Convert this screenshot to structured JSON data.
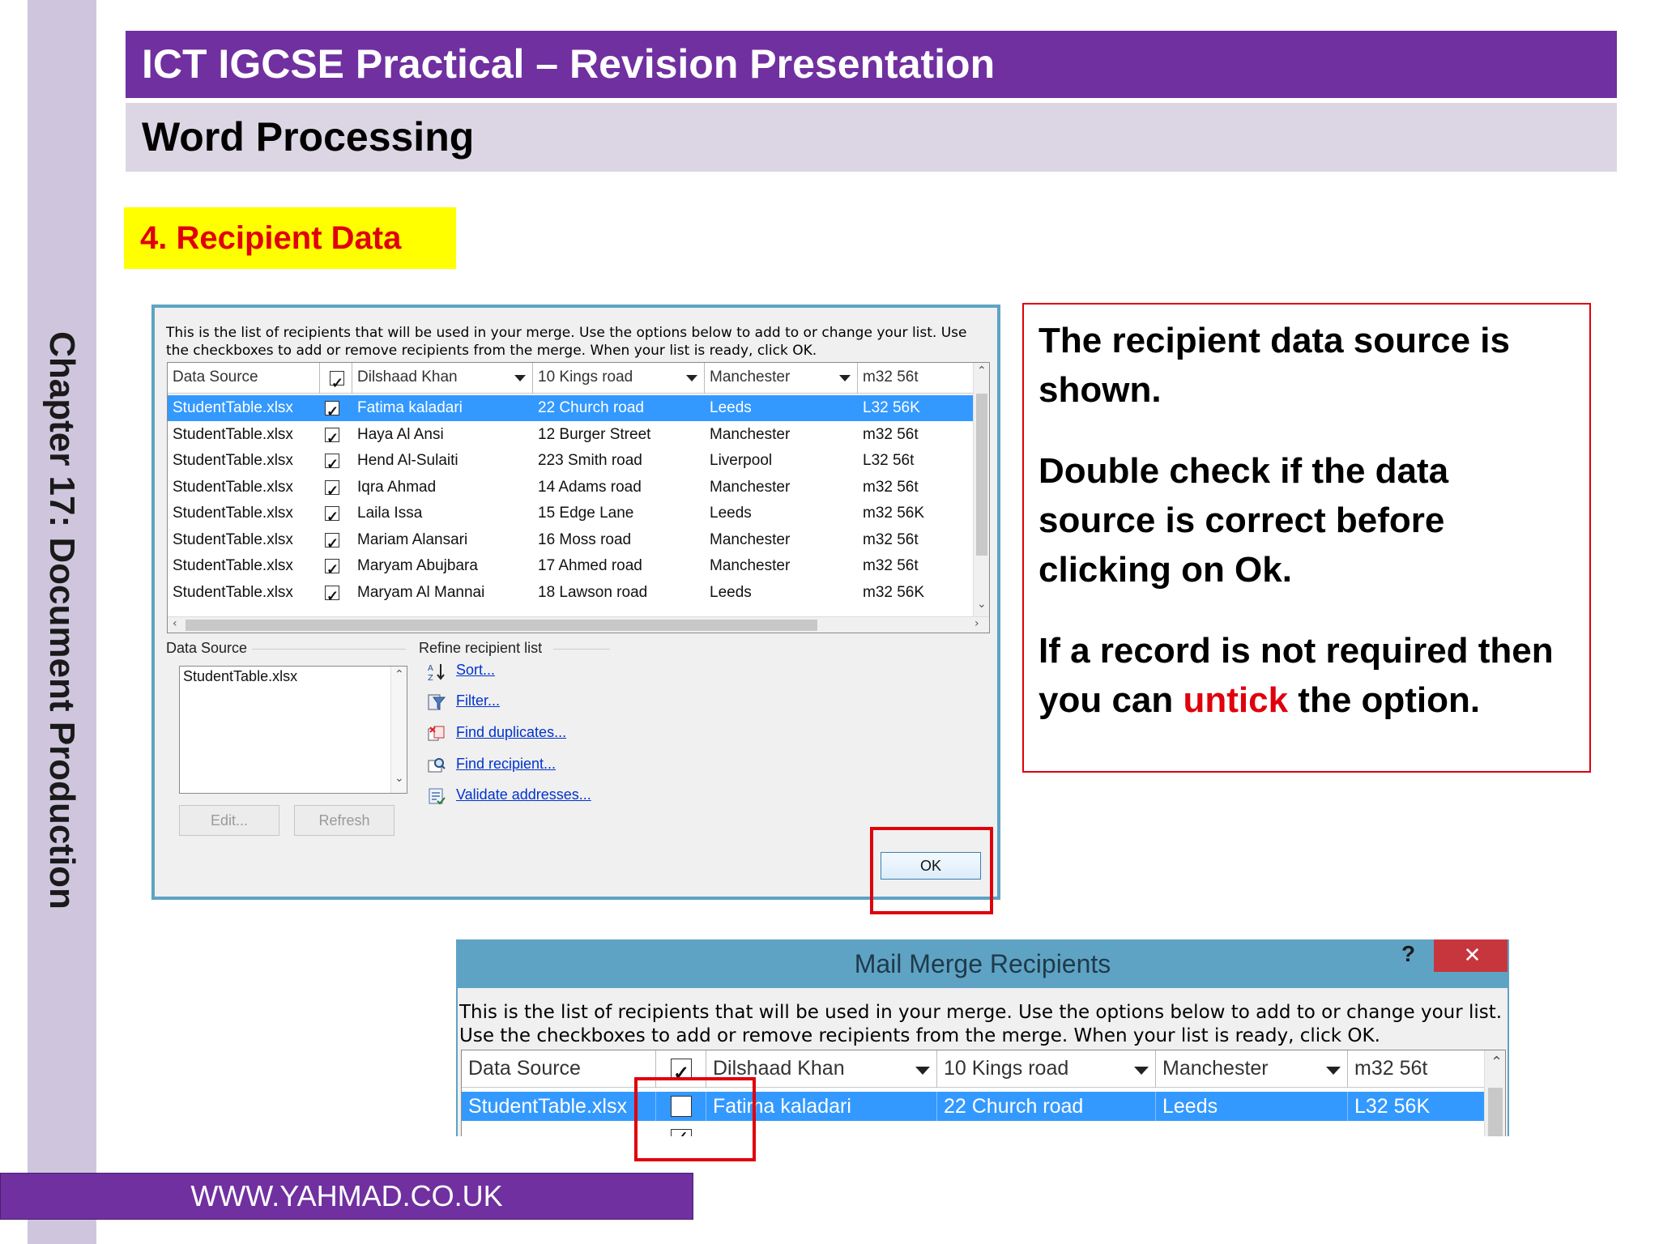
{
  "slide": {
    "title": "ICT IGCSE Practical – Revision Presentation",
    "subtitle": "Word Processing",
    "section": "4. Recipient Data",
    "side_label": "Chapter 17: Document Production",
    "footer": "WWW.YAHMAD.CO.UK"
  },
  "dialog": {
    "title": "Mail Merge Recipients",
    "help": "?",
    "close": "✕",
    "intro": "This is the list of recipients that will be used in your merge.  Use the options below to add to or change your list.  Use the checkboxes to add or remove recipients from the merge.  When your list is ready, click OK.",
    "columns": [
      "Data Source",
      "",
      "Dilshaad Khan",
      "10 Kings road",
      "Manchester",
      "m32 56t"
    ],
    "rows": [
      {
        "source": "StudentTable.xlsx",
        "checked": true,
        "name": "Fatima kaladari",
        "address": "22 Church road",
        "city": "Leeds",
        "postcode": "L32 56K"
      },
      {
        "source": "StudentTable.xlsx",
        "checked": true,
        "name": "Haya Al Ansi",
        "address": "12 Burger Street",
        "city": "Manchester",
        "postcode": "m32 56t"
      },
      {
        "source": "StudentTable.xlsx",
        "checked": true,
        "name": "Hend Al-Sulaiti",
        "address": "223 Smith road",
        "city": "Liverpool",
        "postcode": "L32 56t"
      },
      {
        "source": "StudentTable.xlsx",
        "checked": true,
        "name": "Iqra Ahmad",
        "address": "14 Adams road",
        "city": "Manchester",
        "postcode": "m32 56t"
      },
      {
        "source": "StudentTable.xlsx",
        "checked": true,
        "name": "Laila Issa",
        "address": "15 Edge Lane",
        "city": "Leeds",
        "postcode": "m32 56K"
      },
      {
        "source": "StudentTable.xlsx",
        "checked": true,
        "name": "Mariam Alansari",
        "address": "16 Moss road",
        "city": "Manchester",
        "postcode": "m32 56t"
      },
      {
        "source": "StudentTable.xlsx",
        "checked": true,
        "name": "Maryam Abujbara",
        "address": "17 Ahmed road",
        "city": "Manchester",
        "postcode": "m32 56t"
      },
      {
        "source": "StudentTable.xlsx",
        "checked": true,
        "name": "Maryam Al Mannai",
        "address": "18 Lawson road",
        "city": "Leeds",
        "postcode": "m32 56K"
      }
    ],
    "data_source_label": "Data Source",
    "data_source_item": "StudentTable.xlsx",
    "edit_button": "Edit...",
    "refresh_button": "Refresh",
    "refine_label": "Refine recipient list",
    "refine_links": [
      {
        "label": "Sort...",
        "icon": "sort-icon"
      },
      {
        "label": "Filter...",
        "icon": "filter-icon"
      },
      {
        "label": "Find duplicates...",
        "icon": "duplicates-icon"
      },
      {
        "label": "Find recipient...",
        "icon": "find-recipient-icon"
      },
      {
        "label": "Validate addresses...",
        "icon": "validate-icon"
      }
    ],
    "ok_button": "OK"
  },
  "callout": {
    "para1": "The recipient data source is shown.",
    "para2": "Double check if the data source is correct before clicking on Ok.",
    "para3_before": "If a record is not required then you can ",
    "para3_highlight": "untick",
    "para3_after": " the option."
  },
  "colors": {
    "purple": "#7030a0",
    "lavender": "#dcd6e4",
    "yellow": "#ffff00",
    "red": "#e0000b",
    "selection": "#3399ff",
    "dialog_frame": "#5fa3c4"
  }
}
